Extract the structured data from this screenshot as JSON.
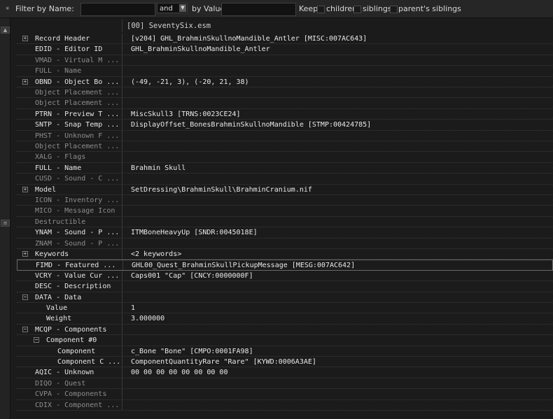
{
  "filter_bar": {
    "filter_by_name_label": "Filter by Name:",
    "name_value": "",
    "operator": "and",
    "by_value_label": "by Value:",
    "value_value": "",
    "keep_label": "Keep",
    "children_label": "children",
    "siblings_label": "siblings",
    "parents_siblings_label": "parent's siblings"
  },
  "header": {
    "file": "[00] SeventySix.esm"
  },
  "rows": [
    {
      "name": "Record Header",
      "value": "[v204] GHL_BrahminSkullnoMandible_Antler [MISC:007AC643]",
      "level": 0,
      "expander": "+",
      "dim": false
    },
    {
      "name": "EDID - Editor ID",
      "value": "GHL_BrahminSkullnoMandible_Antler",
      "level": 0,
      "expander": "",
      "dim": false
    },
    {
      "name": "VMAD - Virtual M ...",
      "value": "",
      "level": 0,
      "expander": "",
      "dim": true
    },
    {
      "name": "FULL - Name",
      "value": "",
      "level": 0,
      "expander": "",
      "dim": true
    },
    {
      "name": "OBND - Object Bo ...",
      "value": "(-49, -21, 3), (-20, 21, 38)",
      "level": 0,
      "expander": "+",
      "dim": false
    },
    {
      "name": "Object Placement ...",
      "value": "",
      "level": 0,
      "expander": "",
      "dim": true
    },
    {
      "name": "Object Placement ...",
      "value": "",
      "level": 0,
      "expander": "",
      "dim": true
    },
    {
      "name": "PTRN - Preview T ...",
      "value": "MiscSkull3 [TRNS:0023CE24]",
      "level": 0,
      "expander": "",
      "dim": false
    },
    {
      "name": "SNTP - Snap Temp ...",
      "value": "DisplayOffset_BonesBrahminSkullnoMandible [STMP:00424785]",
      "level": 0,
      "expander": "",
      "dim": false
    },
    {
      "name": "PHST - Unknown F ...",
      "value": "",
      "level": 0,
      "expander": "",
      "dim": true
    },
    {
      "name": "Object Placement ...",
      "value": "",
      "level": 0,
      "expander": "",
      "dim": true
    },
    {
      "name": "XALG - Flags",
      "value": "",
      "level": 0,
      "expander": "",
      "dim": true
    },
    {
      "name": "FULL - Name",
      "value": "Brahmin Skull",
      "level": 0,
      "expander": "",
      "dim": false
    },
    {
      "name": "CUSD - Sound - C ...",
      "value": "",
      "level": 0,
      "expander": "",
      "dim": true
    },
    {
      "name": "Model",
      "value": "SetDressing\\BrahminSkull\\BrahminCranium.nif",
      "level": 0,
      "expander": "+",
      "dim": false
    },
    {
      "name": "ICON - Inventory ...",
      "value": "",
      "level": 0,
      "expander": "",
      "dim": true
    },
    {
      "name": "MICO - Message Icon",
      "value": "",
      "level": 0,
      "expander": "",
      "dim": true
    },
    {
      "name": "Destructible",
      "value": "",
      "level": 0,
      "expander": "",
      "dim": true
    },
    {
      "name": "YNAM - Sound - P ...",
      "value": "ITMBoneHeavyUp [SNDR:0045018E]",
      "level": 0,
      "expander": "",
      "dim": false
    },
    {
      "name": "ZNAM - Sound - P ...",
      "value": "",
      "level": 0,
      "expander": "",
      "dim": true
    },
    {
      "name": "Keywords",
      "value": "<2 keywords>",
      "level": 0,
      "expander": "+",
      "dim": false
    },
    {
      "name": "FIMD - Featured ...",
      "value": "GHL00_Quest_BrahminSkullPickupMessage [MESG:007AC642]",
      "level": 0,
      "expander": "",
      "dim": false,
      "highlight": true
    },
    {
      "name": "VCRY - Value Cur ...",
      "value": "Caps001 \"Cap\" [CNCY:0000000F]",
      "level": 0,
      "expander": "",
      "dim": false
    },
    {
      "name": "DESC - Description",
      "value": "",
      "level": 0,
      "expander": "",
      "dim": false
    },
    {
      "name": "DATA - Data",
      "value": "",
      "level": 0,
      "expander": "-",
      "dim": false
    },
    {
      "name": "Value",
      "value": "1",
      "level": 1,
      "expander": "",
      "dim": false
    },
    {
      "name": "Weight",
      "value": "3.000000",
      "level": 1,
      "expander": "",
      "dim": false
    },
    {
      "name": "MCQP - Components",
      "value": "",
      "level": 0,
      "expander": "-",
      "dim": false
    },
    {
      "name": "Component #0",
      "value": "",
      "level": 1,
      "expander": "-",
      "dim": false
    },
    {
      "name": "Component",
      "value": "c_Bone \"Bone\" [CMPO:0001FA98]",
      "level": 2,
      "expander": "",
      "dim": false
    },
    {
      "name": "Component C ...",
      "value": "ComponentQuantityRare \"Rare\" [KYWD:0006A3AE]",
      "level": 2,
      "expander": "",
      "dim": false
    },
    {
      "name": "AQIC - Unknown",
      "value": "00 00 00 00 00 00 00 00",
      "level": 0,
      "expander": "",
      "dim": false
    },
    {
      "name": "DIQO - Quest",
      "value": "",
      "level": 0,
      "expander": "",
      "dim": true
    },
    {
      "name": "CVPA - Components",
      "value": "",
      "level": 0,
      "expander": "",
      "dim": true
    },
    {
      "name": "CDIX - Component ...",
      "value": "",
      "level": 0,
      "expander": "",
      "dim": true
    }
  ]
}
